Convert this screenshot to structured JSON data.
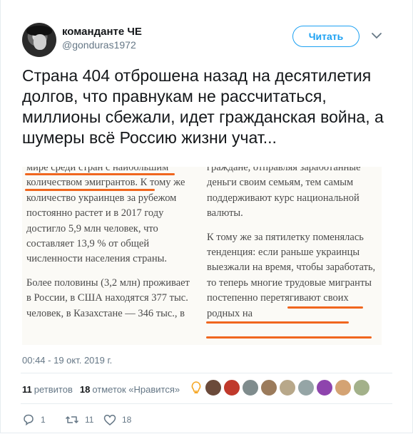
{
  "header": {
    "display_name": "команданте ЧЕ",
    "handle": "@gonduras1972",
    "follow_label": "Читать"
  },
  "tweet": {
    "text": "Страна 404 отброшена назад на десятилетия долгов, что правнукам не рассчитаться, миллионы сбежали, идет гражданская война, а шумеры всё Россию жизни учат..."
  },
  "photo": {
    "left_column": [
      "мире среди стран с наибольшим количеством эмигрантов. К тому же количество украинцев за рубежом постоянно растет и в 2017 году достигло 5,9 млн человек, что составляет 13,9 % от общей численности населения страны.",
      "Более половины (3,2 млн) проживает в России, в США находятся 377 тыс. человек, в Казахстане — 346 тыс., в"
    ],
    "right_column": [
      "граждане, отправляя заработанные деньги своим семьям, тем самым поддерживают курс национальной валюты.",
      "К тому же за пятилетку поменялась тенденция: если раньше украинцы выезжали на время, чтобы заработать, то теперь многие трудовые мигранты постепенно перетягивают своих родных на"
    ],
    "highlight_color": "#f0661e"
  },
  "meta": {
    "timestamp": "00:44 - 19 окт. 2019 г.",
    "retweets_count": "11",
    "retweets_label": "ретвитов",
    "likes_count": "18",
    "likes_label": "отметок «Нравится»"
  },
  "actions": {
    "reply_count": "1",
    "retweet_count": "11",
    "like_count": "18"
  },
  "likers": [
    {
      "icon": "lightbulb-icon",
      "color": "#f5a623"
    },
    {
      "icon": "avatar",
      "color": "#6b4a3a"
    },
    {
      "icon": "avatar",
      "color": "#c0392b"
    },
    {
      "icon": "avatar",
      "color": "#7f8c8d"
    },
    {
      "icon": "avatar",
      "color": "#9b7b5b"
    },
    {
      "icon": "avatar",
      "color": "#b8a88a"
    },
    {
      "icon": "avatar",
      "color": "#95a5a6"
    },
    {
      "icon": "avatar",
      "color": "#8e44ad"
    },
    {
      "icon": "avatar",
      "color": "#d4a373"
    },
    {
      "icon": "avatar",
      "color": "#a3b18a"
    }
  ],
  "colors": {
    "accent": "#1da1f2",
    "muted": "#657786",
    "text": "#14171a"
  }
}
